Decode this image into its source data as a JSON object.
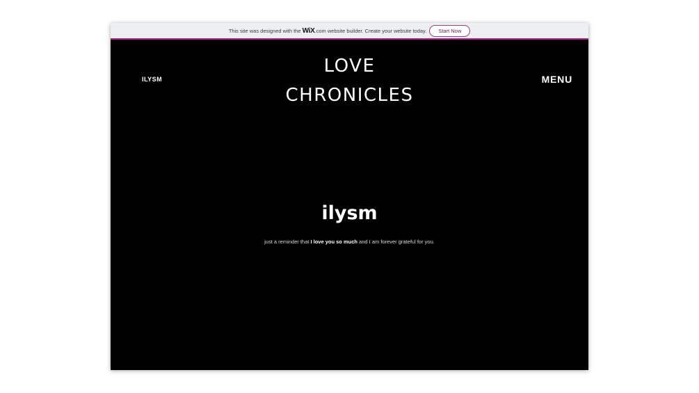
{
  "wix_banner": {
    "text_before": "This site was designed with the",
    "wix_logo": "WiX",
    "dotcom": ".com",
    "text_after": "website builder. Create your website today.",
    "button_label": "Start Now"
  },
  "header": {
    "logo": "ILYSM",
    "title_line1": "LOVE",
    "title_line2": "CHRONICLES",
    "menu_label": "MENU"
  },
  "hero": {
    "heading": "ilysm",
    "text_before": "just a reminder that",
    "text_bold": "I love you so much",
    "text_after": "and I am forever grateful for you."
  },
  "colors": {
    "page_background": "#000000",
    "banner_background": "#eeeff3",
    "banner_accent": "#b0228c"
  }
}
